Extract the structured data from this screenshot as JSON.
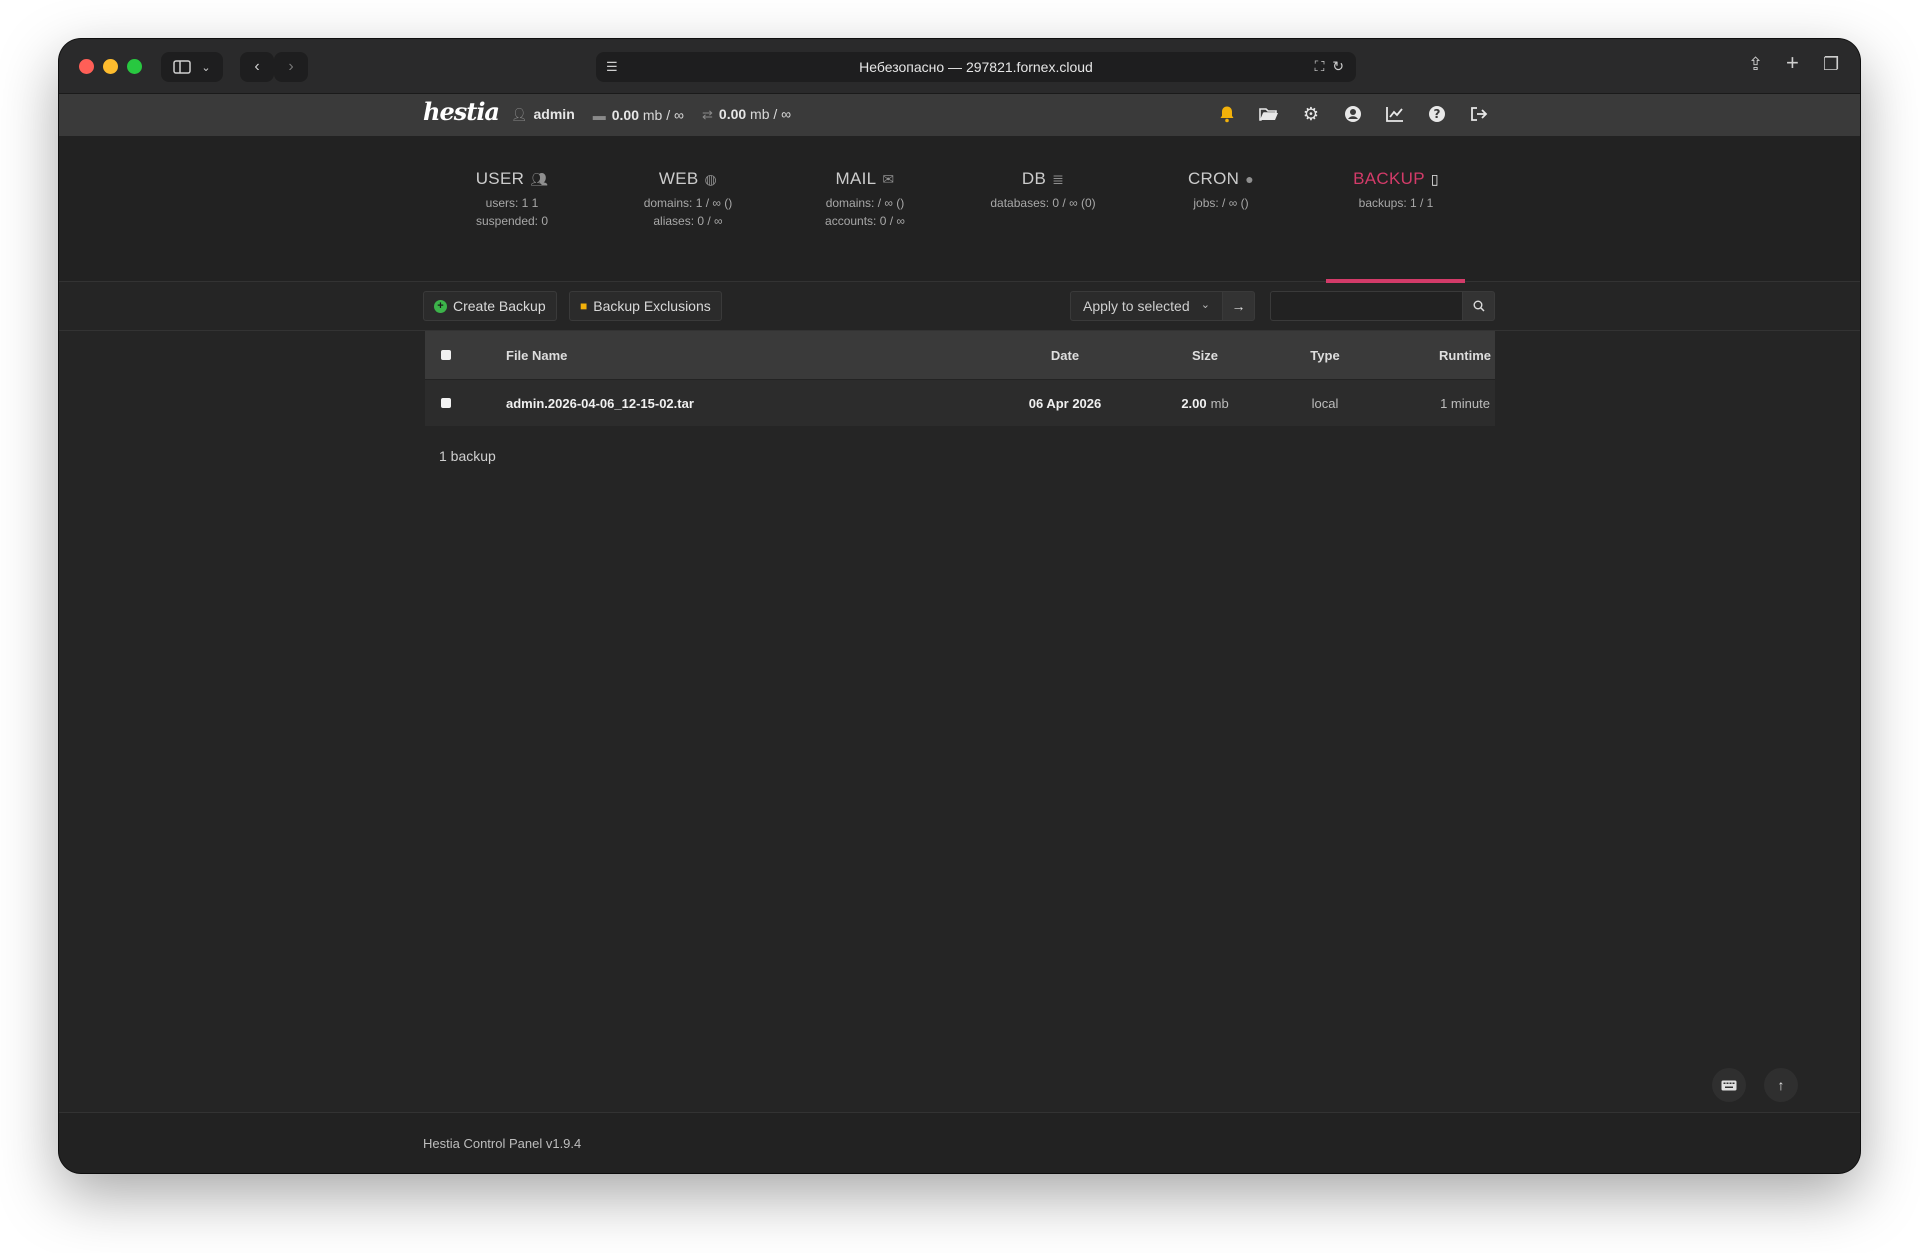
{
  "browser": {
    "address": "Небезопасно — 297821.fornex.cloud",
    "page_icon": "page-menu-icon",
    "translate_icon": "translate-icon",
    "reload_icon": "reload-icon"
  },
  "topbar": {
    "logo": "hestia",
    "user": "admin",
    "disk_value": "0.00",
    "disk_unit": "mb / ∞",
    "bandwidth_value": "0.00",
    "bandwidth_unit": "mb / ∞",
    "icons": [
      "bell-icon",
      "folder-icon",
      "gear-icon",
      "user-circle-icon",
      "chart-icon",
      "help-icon",
      "logout-icon"
    ]
  },
  "summary": [
    {
      "title": "USER",
      "icon": "users-icon",
      "stats": [
        "users: 1 1",
        "suspended: 0"
      ]
    },
    {
      "title": "WEB",
      "icon": "globe-icon",
      "stats": [
        "domains: 1 / ∞ ()",
        "aliases: 0 / ∞"
      ]
    },
    {
      "title": "MAIL",
      "icon": "mail-icon",
      "stats": [
        "domains: / ∞ ()",
        "accounts: 0 / ∞"
      ]
    },
    {
      "title": "DB",
      "icon": "database-icon",
      "stats": [
        "databases: 0 / ∞ (0)"
      ]
    },
    {
      "title": "CRON",
      "icon": "clock-icon",
      "stats": [
        "jobs: / ∞ ()"
      ]
    },
    {
      "title": "BACKUP",
      "icon": "file-archive-icon",
      "stats": [
        "backups: 1 / 1"
      ],
      "active": true
    }
  ],
  "toolbar": {
    "create_label": "Create Backup",
    "exclusions_label": "Backup Exclusions",
    "bulk_select": "Apply to selected",
    "search_value": ""
  },
  "table": {
    "headers": {
      "name": "File Name",
      "date": "Date",
      "size": "Size",
      "type": "Type",
      "runtime": "Runtime"
    },
    "rows": [
      {
        "name": "admin.2026-04-06_12-15-02.tar",
        "date": "06 Apr 2026",
        "size": "2.00",
        "size_unit": "mb",
        "type": "local",
        "runtime": "1 minute"
      }
    ]
  },
  "count": "1 backup",
  "footer": "Hestia Control Panel v1.9.4",
  "colors": {
    "accent": "#d33b69",
    "bell": "#f2b10a",
    "create": "#3cb34a"
  }
}
